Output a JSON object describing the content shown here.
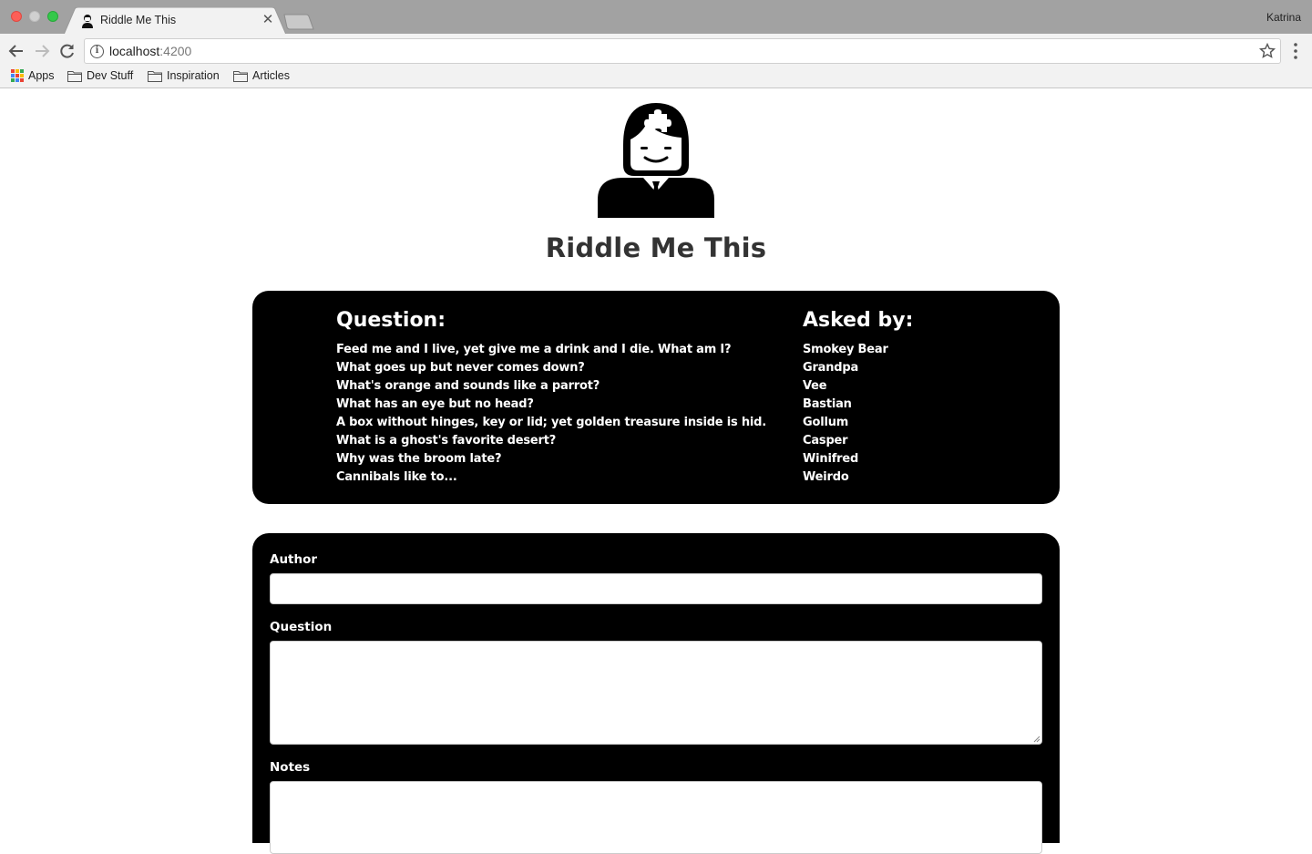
{
  "browser": {
    "tab_title": "Riddle Me This",
    "profile_name": "Katrina",
    "url_host": "localhost",
    "url_port": ":4200",
    "bookmarks": [
      {
        "label": "Apps",
        "icon": "apps-grid-icon"
      },
      {
        "label": "Dev Stuff",
        "icon": "folder-icon"
      },
      {
        "label": "Inspiration",
        "icon": "folder-icon"
      },
      {
        "label": "Articles",
        "icon": "folder-icon"
      }
    ]
  },
  "header": {
    "logo_icon": "puzzle-head-man-icon",
    "title": "Riddle Me This"
  },
  "riddles": {
    "question_heading": "Question:",
    "author_heading": "Asked by:",
    "items": [
      {
        "question": "Feed me and I live, yet give me a drink and I die. What am I?",
        "author": "Smokey Bear"
      },
      {
        "question": "What goes up but never comes down?",
        "author": "Grandpa"
      },
      {
        "question": "What's orange and sounds like a parrot?",
        "author": "Vee"
      },
      {
        "question": "What has an eye but no head?",
        "author": "Bastian"
      },
      {
        "question": "A box without hinges, key or lid; yet golden treasure inside is hid.",
        "author": "Gollum"
      },
      {
        "question": "What is a ghost's favorite desert?",
        "author": "Casper"
      },
      {
        "question": "Why was the broom late?",
        "author": "Winifred"
      },
      {
        "question": "Cannibals like to...",
        "author": "Weirdo"
      }
    ]
  },
  "form": {
    "author_label": "Author",
    "author_value": "",
    "question_label": "Question",
    "question_value": "",
    "notes_label": "Notes",
    "notes_value": ""
  },
  "colors": {
    "card_background": "#000000",
    "card_text": "#ffffff",
    "title_text": "#333333"
  }
}
